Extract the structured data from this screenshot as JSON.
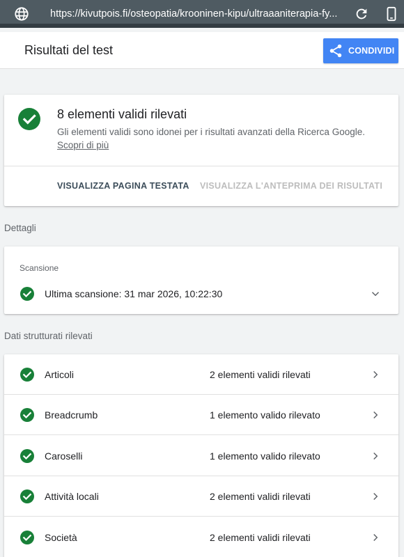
{
  "browser": {
    "url": "https://kivutpois.fi/osteopatia/krooninen-kipu/ultraaaniterapia-fy..."
  },
  "header": {
    "title": "Risultati del test",
    "share_label": "CONDIVIDI"
  },
  "summary": {
    "headline": "8 elementi validi rilevati",
    "description": "Gli elementi validi sono idonei per i risultati avanzati della Ricerca Google.",
    "learn_more": "Scopri di più",
    "action_view_page": "VISUALIZZA PAGINA TESTATA",
    "action_preview": "VISUALIZZA L'ANTEPRIMA DEI RISULTATI"
  },
  "details": {
    "section_label": "Dettagli",
    "crawl_label": "Scansione",
    "crawl_text": "Ultima scansione: 31 mar 2026, 10:22:30"
  },
  "structured_data": {
    "section_label": "Dati strutturati rilevati",
    "items": [
      {
        "name": "Articoli",
        "count": "2 elementi validi rilevati"
      },
      {
        "name": "Breadcrumb",
        "count": "1 elemento valido rilevato"
      },
      {
        "name": "Caroselli",
        "count": "1 elemento valido rilevato"
      },
      {
        "name": "Attività locali",
        "count": "2 elementi validi rilevati"
      },
      {
        "name": "Società",
        "count": "2 elementi validi rilevati"
      }
    ]
  },
  "colors": {
    "success": "#188038",
    "accent": "#4285f4",
    "toolbar": "#4f5b62"
  }
}
